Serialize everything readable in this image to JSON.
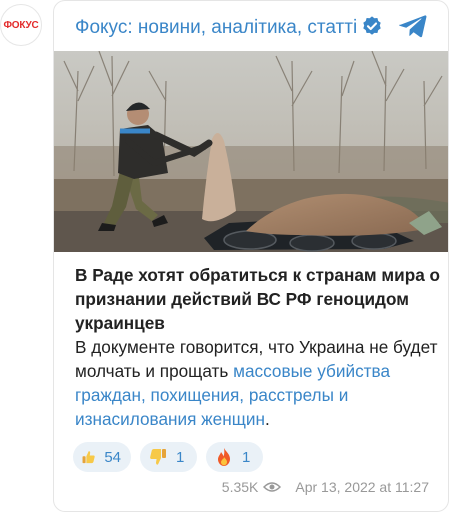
{
  "avatar": {
    "text": "ФОКУС"
  },
  "channel": {
    "title": "Фокус: новини, аналітика, статті"
  },
  "post": {
    "headline": "В Раде хотят обратиться к странам мира о признании действий ВС РФ геноцидом украинцев",
    "body_prefix": "В документе говорится, что Украина не будет молчать и прощать ",
    "body_link": "массовые убийства граждан, похищения, расстрелы и изнасилования женщин",
    "body_suffix": "."
  },
  "reactions": [
    {
      "icon": "thumbs-up-icon",
      "count": "54"
    },
    {
      "icon": "thumbs-down-icon",
      "count": "1"
    },
    {
      "icon": "fire-icon",
      "count": "1"
    }
  ],
  "meta": {
    "views": "5.35K",
    "date": "Apr 13, 2022 at 11:27"
  },
  "colors": {
    "accent": "#3a86c8",
    "brand_red": "#e32b2b",
    "text": "#222222",
    "muted": "#999999",
    "reaction_bg": "#eaf1f7"
  }
}
